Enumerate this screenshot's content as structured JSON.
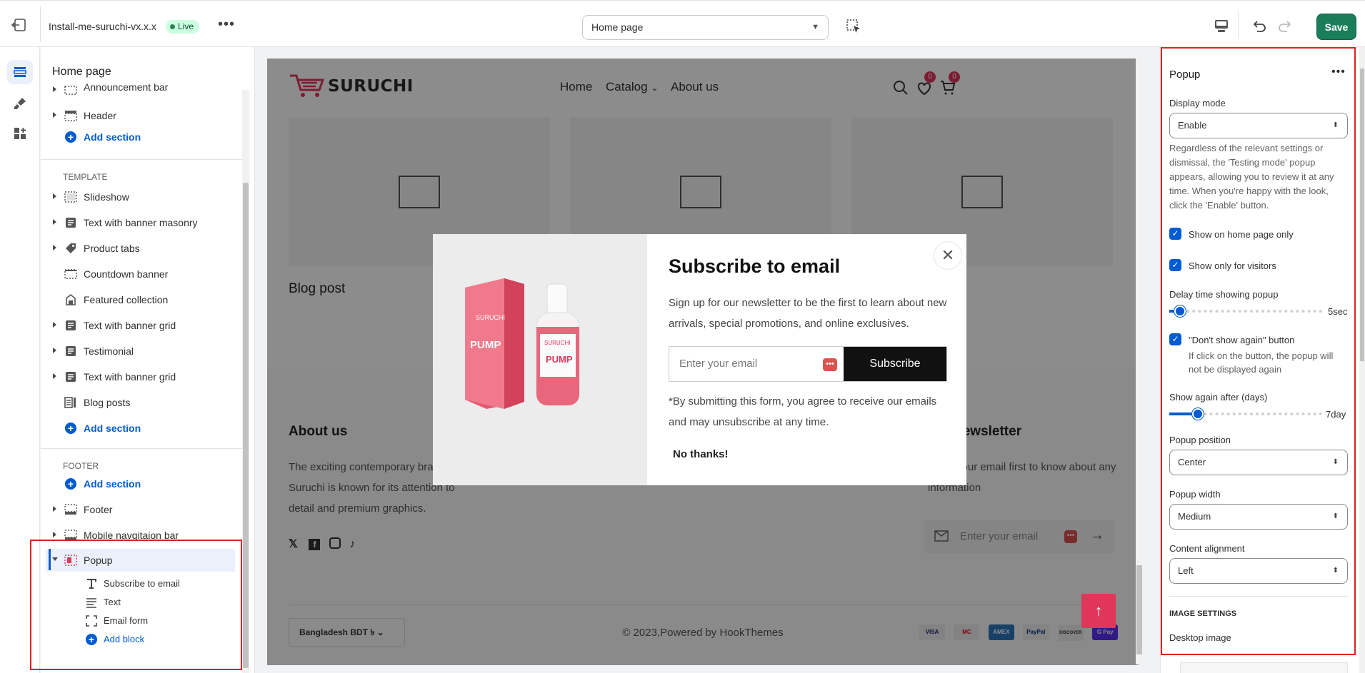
{
  "topbar": {
    "store_name": "Install-me-suruchi-vx.x.x",
    "status_badge": "Live",
    "page_selector": "Home page",
    "save_label": "Save"
  },
  "left_panel": {
    "title": "Home page",
    "header_group": [
      {
        "label": "Announcement bar",
        "icon": "section-icon"
      },
      {
        "label": "Header",
        "icon": "header-icon"
      }
    ],
    "add_section": "Add section",
    "template_label": "TEMPLATE",
    "template_items": [
      {
        "label": "Slideshow",
        "icon": "slideshow-icon",
        "expandable": true
      },
      {
        "label": "Text with banner masonry",
        "icon": "text-block-icon",
        "expandable": true
      },
      {
        "label": "Product tabs",
        "icon": "tag-icon",
        "expandable": true
      },
      {
        "label": "Countdown banner",
        "icon": "section-icon",
        "expandable": false
      },
      {
        "label": "Featured collection",
        "icon": "collection-icon",
        "expandable": false
      },
      {
        "label": "Text with banner grid",
        "icon": "text-block-icon",
        "expandable": true
      },
      {
        "label": "Testimonial",
        "icon": "text-block-icon",
        "expandable": true
      },
      {
        "label": "Text with banner grid",
        "icon": "text-block-icon",
        "expandable": true
      },
      {
        "label": "Blog posts",
        "icon": "blog-icon",
        "expandable": false
      }
    ],
    "footer_label": "FOOTER",
    "footer_items": [
      {
        "label": "Footer",
        "icon": "section-icon"
      },
      {
        "label": "Mobile navgitaion bar",
        "icon": "section-icon"
      }
    ],
    "popup": {
      "label": "Popup",
      "children": [
        {
          "label": "Subscribe to email",
          "icon": "heading-icon"
        },
        {
          "label": "Text",
          "icon": "paragraph-icon"
        },
        {
          "label": "Email form",
          "icon": "form-icon"
        }
      ],
      "add_block": "Add block"
    }
  },
  "preview": {
    "logo_text": "SURUCHI",
    "nav": [
      "Home",
      "Catalog",
      "About us"
    ],
    "wishlist_count": "0",
    "cart_count": "0",
    "blog_title": "Blog post",
    "about_title": "About us",
    "about_text": "The exciting contemporary brand Suruchi is known for its attention to detail and premium graphics.",
    "newsletter_title": "Newsletter",
    "newsletter_text": "Enter your email first to know about any information",
    "newsletter_placeholder": "Enter your email",
    "currency": "Bangladesh BDT ৳",
    "copyright": "© 2023,Powered by HookThemes",
    "payments": [
      "VISA",
      "MC",
      "AMEX",
      "PayPal",
      "DISCOVER",
      "G Pay"
    ],
    "colors": {
      "accent": "#e0365a"
    }
  },
  "popup": {
    "title": "Subscribe to email",
    "description": "Sign up for our newsletter to be the first to learn about new arrivals, special promotions, and online exclusives.",
    "email_placeholder": "Enter your email",
    "subscribe_label": "Subscribe",
    "note": "*By submitting this form, you agree to receive our emails and may unsubscribe at any time.",
    "no_thanks": "No thanks!",
    "product_brand": "SURUCHI",
    "product_name": "PUMP"
  },
  "settings": {
    "title": "Popup",
    "display_mode_label": "Display mode",
    "display_mode_value": "Enable",
    "display_help": "Regardless of the relevant settings or dismissal, the 'Testing mode' popup appears, allowing you to review it at any time. When you're happy with the look, click the 'Enable' button.",
    "show_home_only": "Show on home page only",
    "show_visitors_only": "Show only for visitors",
    "delay_label": "Delay time showing popup",
    "delay_value": "5sec",
    "delay_fraction": 0.05,
    "dont_show_label": "\"Don't show again\" button",
    "dont_show_help": "If click on the button, the popup will not be displayed again",
    "show_again_label": "Show again after (days)",
    "show_again_value": "7day",
    "show_again_fraction": 0.17,
    "position_label": "Popup position",
    "position_value": "Center",
    "width_label": "Popup width",
    "width_value": "Medium",
    "alignment_label": "Content alignment",
    "alignment_value": "Left",
    "image_settings": "IMAGE SETTINGS",
    "desktop_image": "Desktop image"
  }
}
